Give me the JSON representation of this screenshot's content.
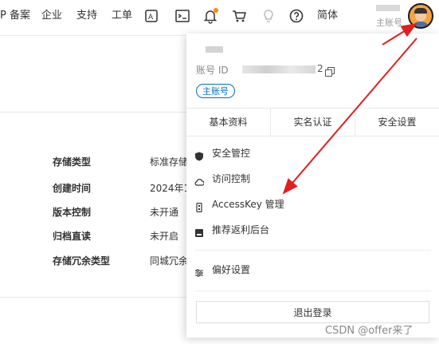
{
  "topbar": {
    "nav": [
      "P 备案",
      "企业",
      "支持",
      "工单"
    ],
    "icons": [
      "app-icon",
      "terminal-icon",
      "bell-icon",
      "cart-icon",
      "lightbulb-icon",
      "help-icon"
    ],
    "lang": "简体",
    "account_sub": "主账号"
  },
  "details": {
    "rows": [
      {
        "label": "存储类型",
        "value": "标准存储"
      },
      {
        "label": "创建时间",
        "value": "2024年1"
      },
      {
        "label": "版本控制",
        "value": "未开通"
      },
      {
        "label": "归档直读",
        "value": "未开启"
      },
      {
        "label": "存储冗余类型",
        "value": "同城冗余"
      }
    ]
  },
  "dropdown": {
    "id_label": "账号 ID",
    "id_suffix": "2",
    "badge": "主账号",
    "tabs": [
      "基本资料",
      "实名认证",
      "安全设置"
    ],
    "items": [
      {
        "label": "安全管控",
        "icon": "shield-icon"
      },
      {
        "label": "访问控制",
        "icon": "cloud-icon"
      },
      {
        "label": "AccessKey 管理",
        "icon": "key-icon"
      },
      {
        "label": "推荐返利后台",
        "icon": "reward-icon"
      }
    ],
    "prefs": {
      "label": "偏好设置",
      "icon": "sliders-icon"
    },
    "logout": "退出登录"
  },
  "annotation": {
    "color": "#e02020"
  },
  "watermark": "CSDN @offer来了"
}
